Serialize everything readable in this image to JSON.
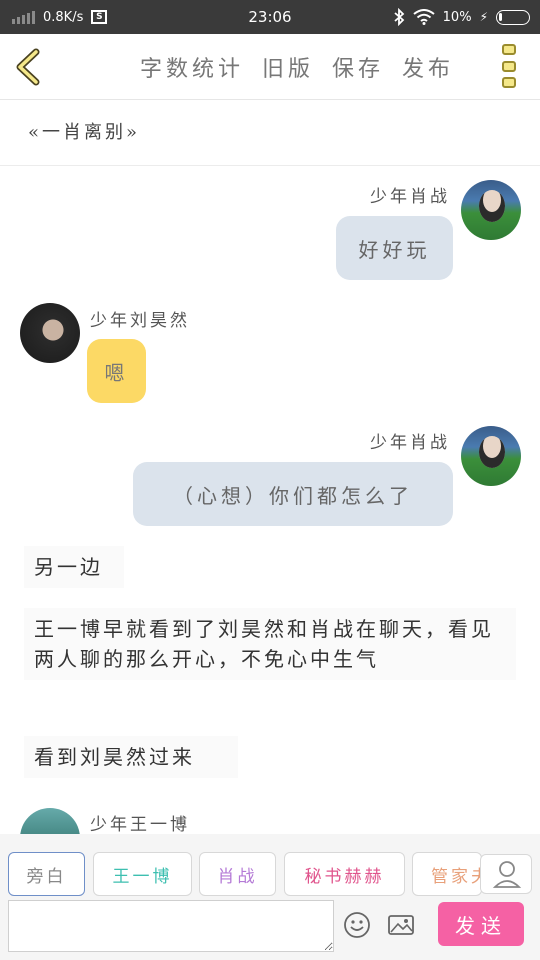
{
  "status_bar": {
    "speed": "0.8K/s",
    "screenshot_icon": "S",
    "time": "23:06",
    "battery": "10%",
    "icons": [
      "signal-icon",
      "screenshot-icon",
      "bluetooth-icon",
      "wifi-icon",
      "battery-icon"
    ]
  },
  "header": {
    "back_icon": "chevron-left-icon",
    "actions": [
      "字数统计",
      "旧版",
      "保存",
      "发布"
    ],
    "menu_icon": "more-vertical-icon"
  },
  "chapter_title": "«一肖离别»",
  "messages": [
    {
      "side": "right",
      "name": "少年肖战",
      "text": "好好玩",
      "style": "blue"
    },
    {
      "side": "left",
      "name": "少年刘昊然",
      "text": "嗯",
      "style": "yellow"
    },
    {
      "side": "right",
      "name": "少年肖战",
      "text": "（心想）你们都怎么了",
      "style": "blue"
    }
  ],
  "narrations": [
    "另一边",
    "王一博早就看到了刘昊然和肖战在聊天，看见两人聊的那么开心，不免心中生气",
    "看到刘昊然过来"
  ],
  "partial_message": {
    "side": "left",
    "name": "少年王一博"
  },
  "roles": [
    {
      "label": "旁白",
      "color": "#888888",
      "active": true
    },
    {
      "label": "王一博",
      "color": "#3dbfb0",
      "active": false
    },
    {
      "label": "肖战",
      "color": "#b47ad6",
      "active": false
    },
    {
      "label": "秘书赫赫",
      "color": "#e0548c",
      "active": false
    },
    {
      "label": "管家夫",
      "color": "#e8a07a",
      "active": false
    }
  ],
  "input": {
    "value": "",
    "placeholder": "",
    "send_label": "发送",
    "emoji_icon": "smiley-icon",
    "image_icon": "image-icon",
    "contact_icon": "person-icon"
  },
  "colors": {
    "accent_pink": "#f561a4",
    "bubble_blue": "#dbe3ec",
    "bubble_yellow": "#fcd965",
    "status_bar": "#3a3a3a"
  }
}
